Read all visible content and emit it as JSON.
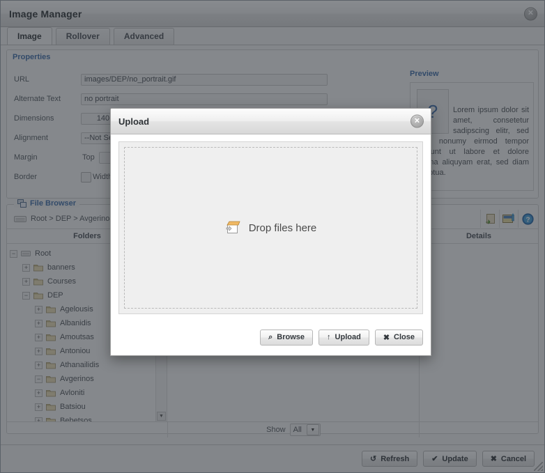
{
  "window": {
    "title": "Image Manager",
    "close_label": "✕"
  },
  "tabs": [
    {
      "label": "Image",
      "active": true
    },
    {
      "label": "Rollover",
      "active": false
    },
    {
      "label": "Advanced",
      "active": false
    }
  ],
  "properties": {
    "legend": "Properties",
    "fields": {
      "url": {
        "label": "URL",
        "value": "images/DEP/no_portrait.gif"
      },
      "alternate_text": {
        "label": "Alternate Text",
        "value": "no portrait"
      },
      "dimensions": {
        "label": "Dimensions",
        "width": "140",
        "height": ""
      },
      "alignment": {
        "label": "Alignment",
        "value": "--Not Set--"
      },
      "margin": {
        "label": "Margin",
        "side_label": "Top",
        "value": ""
      },
      "border": {
        "label": "Border",
        "width_label": "Width"
      }
    }
  },
  "preview": {
    "heading": "Preview",
    "thumb_glyph": "?",
    "text": "Lorem ipsum dolor sit amet, consetetur sadipscing elitr, sed diam nonumy eirmod tempor invidunt ut labore et dolore magna aliquyam erat, sed diam voluptua."
  },
  "file_browser": {
    "legend": "File Browser",
    "breadcrumb": "Root > DEP > Avgerinos",
    "columns": {
      "folders": "Folders",
      "files": "",
      "details": "Details"
    },
    "toolbar_icons": [
      {
        "name": "new-folder-icon"
      },
      {
        "name": "upload-image-icon"
      },
      {
        "name": "help-icon"
      }
    ],
    "tree": [
      {
        "label": "Root",
        "depth": 0,
        "toggle": "−",
        "open": true,
        "type": "drive"
      },
      {
        "label": "banners",
        "depth": 1,
        "toggle": "+",
        "open": false,
        "type": "folder"
      },
      {
        "label": "Courses",
        "depth": 1,
        "toggle": "+",
        "open": false,
        "type": "folder"
      },
      {
        "label": "DEP",
        "depth": 1,
        "toggle": "−",
        "open": true,
        "type": "folder"
      },
      {
        "label": "Agelousis",
        "depth": 2,
        "toggle": "+",
        "open": false,
        "type": "folder"
      },
      {
        "label": "Albanidis",
        "depth": 2,
        "toggle": "+",
        "open": false,
        "type": "folder"
      },
      {
        "label": "Amoutsas",
        "depth": 2,
        "toggle": "+",
        "open": false,
        "type": "folder"
      },
      {
        "label": "Antoniou",
        "depth": 2,
        "toggle": "+",
        "open": false,
        "type": "folder"
      },
      {
        "label": "Athanailidis",
        "depth": 2,
        "toggle": "+",
        "open": false,
        "type": "folder"
      },
      {
        "label": "Avgerinos",
        "depth": 2,
        "toggle": "−",
        "open": true,
        "type": "folder"
      },
      {
        "label": "Avloniti",
        "depth": 2,
        "toggle": "+",
        "open": false,
        "type": "folder"
      },
      {
        "label": "Batsiou",
        "depth": 2,
        "toggle": "+",
        "open": false,
        "type": "folder"
      },
      {
        "label": "Bebetsos",
        "depth": 2,
        "toggle": "+",
        "open": false,
        "type": "folder"
      }
    ],
    "footer": {
      "show_label": "Show",
      "show_value": "All"
    }
  },
  "actions": [
    {
      "name": "refresh-button",
      "icon": "↺",
      "label": "Refresh"
    },
    {
      "name": "update-button",
      "icon": "✔",
      "label": "Update"
    },
    {
      "name": "cancel-button",
      "icon": "✖",
      "label": "Cancel"
    }
  ],
  "upload_dialog": {
    "title": "Upload",
    "close_label": "✕",
    "dropzone_text": "Drop files here",
    "buttons": [
      {
        "name": "browse-button",
        "icon": "⌕",
        "label": "Browse"
      },
      {
        "name": "upload-button",
        "icon": "↑",
        "label": "Upload"
      },
      {
        "name": "close-button",
        "icon": "✖",
        "label": "Close"
      }
    ]
  },
  "colors": {
    "accent": "#3f6ea8",
    "dim_overlay": "rgba(40,46,52,0.55)",
    "window_bg": "#f2f2f2"
  }
}
